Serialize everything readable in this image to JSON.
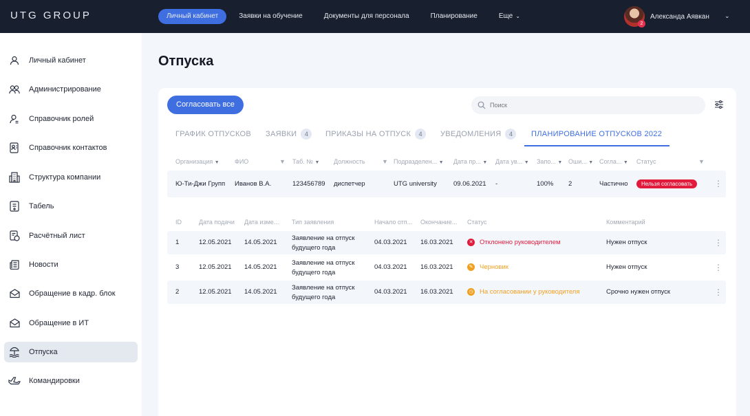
{
  "header": {
    "logo": "UTG GROUP",
    "nav": [
      {
        "label": "Личный кабинет",
        "active": true
      },
      {
        "label": "Заявки на обучение"
      },
      {
        "label": "Документы для персонала"
      },
      {
        "label": "Планирование"
      },
      {
        "label": "Еще"
      }
    ],
    "user": {
      "name": "Александа Аявкан",
      "badge": "2"
    }
  },
  "sidebar": {
    "items": [
      {
        "label": "Личный кабинет",
        "icon": "user-icon"
      },
      {
        "label": "Администрирование",
        "icon": "users-icon"
      },
      {
        "label": "Справочник ролей",
        "icon": "user-role-icon"
      },
      {
        "label": "Справочник контактов",
        "icon": "contacts-icon"
      },
      {
        "label": "Структура компании",
        "icon": "building-icon"
      },
      {
        "label": "Табель",
        "icon": "timesheet-icon"
      },
      {
        "label": "Расчётный лист",
        "icon": "payslip-icon"
      },
      {
        "label": "Новости",
        "icon": "news-icon"
      },
      {
        "label": "Обращение в кадр. блок",
        "icon": "mail-icon"
      },
      {
        "label": "Обращение в ИТ",
        "icon": "mail-it-icon"
      },
      {
        "label": "Отпуска",
        "icon": "beach-icon",
        "active": true
      },
      {
        "label": "Командировки",
        "icon": "plane-icon"
      }
    ]
  },
  "page": {
    "title": "Отпуска",
    "approve_all": "Согласовать все",
    "search_placeholder": "Поиск",
    "tabs": [
      {
        "label": "ГРАФИК ОТПУСКОВ",
        "count": ""
      },
      {
        "label": "ЗАЯВКИ",
        "count": "4"
      },
      {
        "label": "ПРИКАЗЫ НА ОТПУСК",
        "count": "4"
      },
      {
        "label": "УВЕДОМЛЕНИЯ",
        "count": "4"
      },
      {
        "label": "ПЛАНИРОВАНИЕ ОТПУСКОВ 2022",
        "count": "",
        "active": true
      }
    ]
  },
  "plan_table": {
    "headers": [
      "Организация",
      "ФИО",
      "Таб. №",
      "Должность",
      "Подразделен...",
      "Дата пр...",
      "Дата ув...",
      "Запо...",
      "Оши...",
      "Согла...",
      "Статус"
    ],
    "row": {
      "org": "Ю-Ти-Джи Групп",
      "fio": "Иванов В.А.",
      "tab": "123456789",
      "position": "диспетчер",
      "dept": "UTG university",
      "date_hire": "09.06.2021",
      "date_fire": "-",
      "filled": "100%",
      "errors": "2",
      "agreed": "Частично",
      "status": "Нельзя согласовать"
    }
  },
  "requests_table": {
    "headers": [
      "ID",
      "Дата подачи",
      "Дата изме...",
      "Тип заявления",
      "Начало отп...",
      "Окончание...",
      "Статус",
      "Комментарий"
    ],
    "rows": [
      {
        "id": "1",
        "submitted": "12.05.2021",
        "changed": "14.05.2021",
        "type": "Заявление на отпуск будущего года",
        "start": "04.03.2021",
        "end": "16.03.2021",
        "status": "Отклонено руководителем",
        "status_color": "#e21b3c",
        "status_icon": "✕",
        "comment": "Нужен отпуск"
      },
      {
        "id": "3",
        "submitted": "12.05.2021",
        "changed": "14.05.2021",
        "type": "Заявление на отпуск будущего года",
        "start": "04.03.2021",
        "end": "16.03.2021",
        "status": "Черновик",
        "status_color": "#f0a020",
        "status_icon": "✎",
        "comment": "Нужен отпуск"
      },
      {
        "id": "2",
        "submitted": "12.05.2021",
        "changed": "14.05.2021",
        "type": "Заявление на отпуск будущего года",
        "start": "04.03.2021",
        "end": "16.03.2021",
        "status": "На согласовании у руководителя",
        "status_color": "#f0a020",
        "status_icon": "◷",
        "comment": "Срочно нужен отпуск"
      }
    ]
  }
}
